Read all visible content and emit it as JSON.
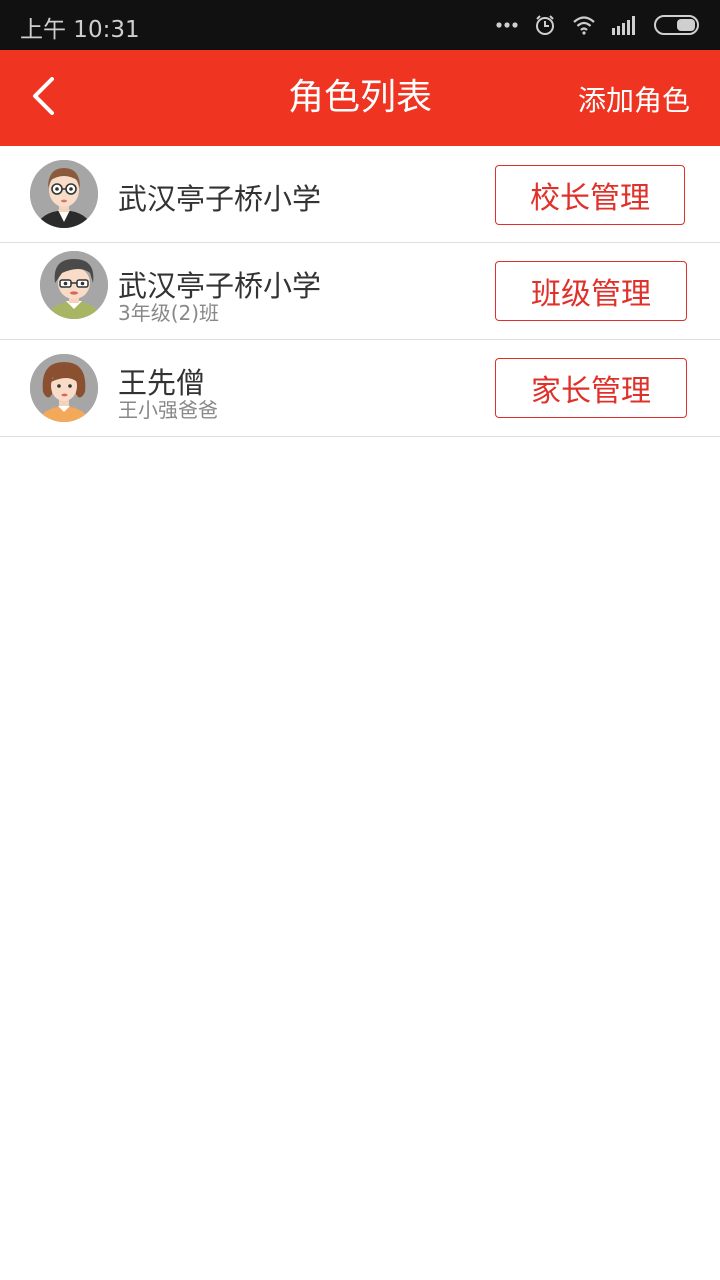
{
  "status_bar": {
    "time": "上午 10:31",
    "icons": [
      "more-dots-icon",
      "alarm-icon",
      "wifi-icon",
      "signal-icon",
      "battery-icon"
    ]
  },
  "header": {
    "title": "角色列表",
    "add_label": "添加角色",
    "back_icon": "back-chevron-icon",
    "background": "#f03422"
  },
  "roles": [
    {
      "name": "武汉亭子桥小学",
      "subtitle": "",
      "button_label": "校长管理",
      "avatar": "principal-avatar"
    },
    {
      "name": "武汉亭子桥小学",
      "subtitle": "3年级(2)班",
      "button_label": "班级管理",
      "avatar": "teacher-avatar"
    },
    {
      "name": "王先僧",
      "subtitle": "王小强爸爸",
      "button_label": "家长管理",
      "avatar": "parent-avatar"
    }
  ],
  "colors": {
    "accent": "#e0302a",
    "status_bar": "#111111"
  }
}
